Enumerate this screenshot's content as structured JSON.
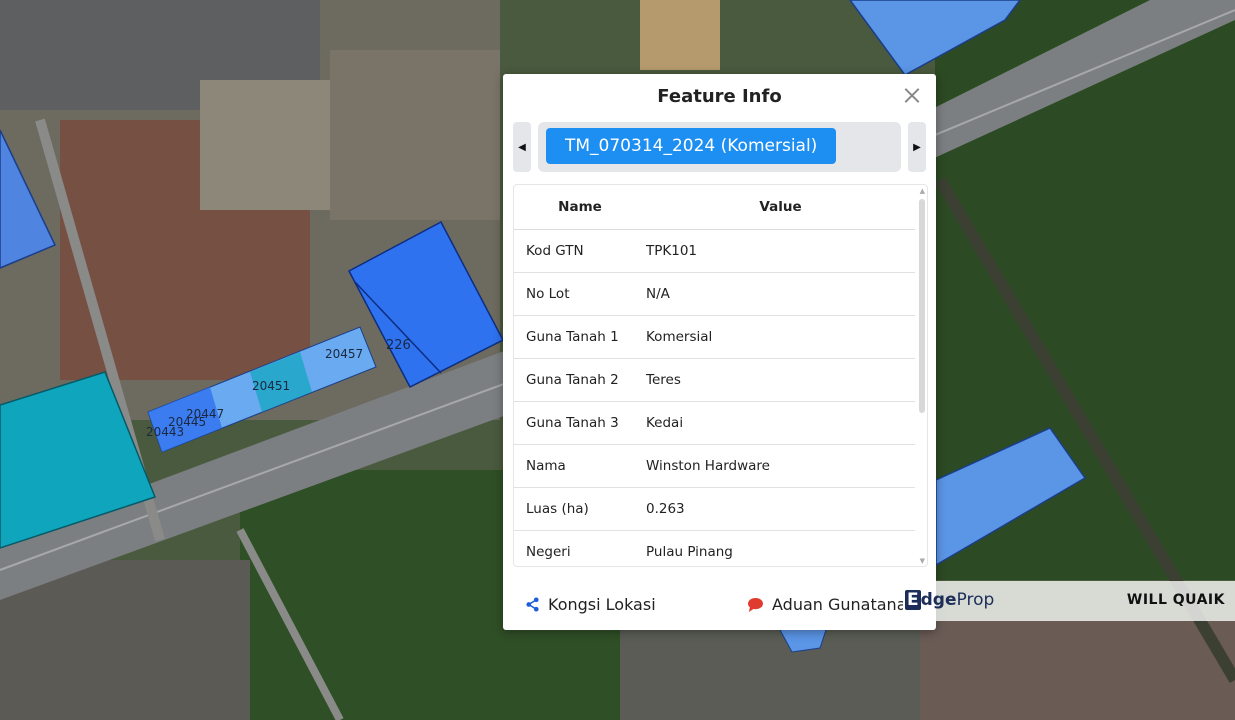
{
  "map": {
    "lot_labels": [
      "226",
      "20443",
      "20445",
      "20447",
      "20451",
      "20457"
    ],
    "colors": {
      "parcel_blue": "#2f72f0",
      "parcel_light": "#5b95e6",
      "parcel_teal": "#0ea5bd",
      "road": "#7c7f82",
      "vegetation": "#2c4a23"
    }
  },
  "popup": {
    "title": "Feature Info",
    "close_icon": "close-icon",
    "prev_icon": "caret-left-icon",
    "next_icon": "caret-right-icon",
    "active_tab": "TM_070314_2024 (Komersial)",
    "table": {
      "headers": [
        "Name",
        "Value"
      ],
      "rows": [
        [
          "Kod GTN",
          "TPK101"
        ],
        [
          "No Lot",
          "N/A"
        ],
        [
          "Guna Tanah 1",
          "Komersial"
        ],
        [
          "Guna Tanah 2",
          "Teres"
        ],
        [
          "Guna Tanah 3",
          "Kedai"
        ],
        [
          "Nama",
          "Winston Hardware"
        ],
        [
          "Luas (ha)",
          "0.263"
        ],
        [
          "Negeri",
          "Pulau Pinang"
        ]
      ]
    },
    "footer": {
      "share_label": "Kongsi Lokasi",
      "share_icon": "share-icon",
      "report_label": "Aduan Gunatanah",
      "report_icon": "chat-bubble-icon"
    },
    "accent": "#1e8ff2"
  },
  "watermark": {
    "logo_e": "E",
    "logo_dge": "dge",
    "logo_prop": "Prop",
    "agent": "WILL QUAIK"
  }
}
